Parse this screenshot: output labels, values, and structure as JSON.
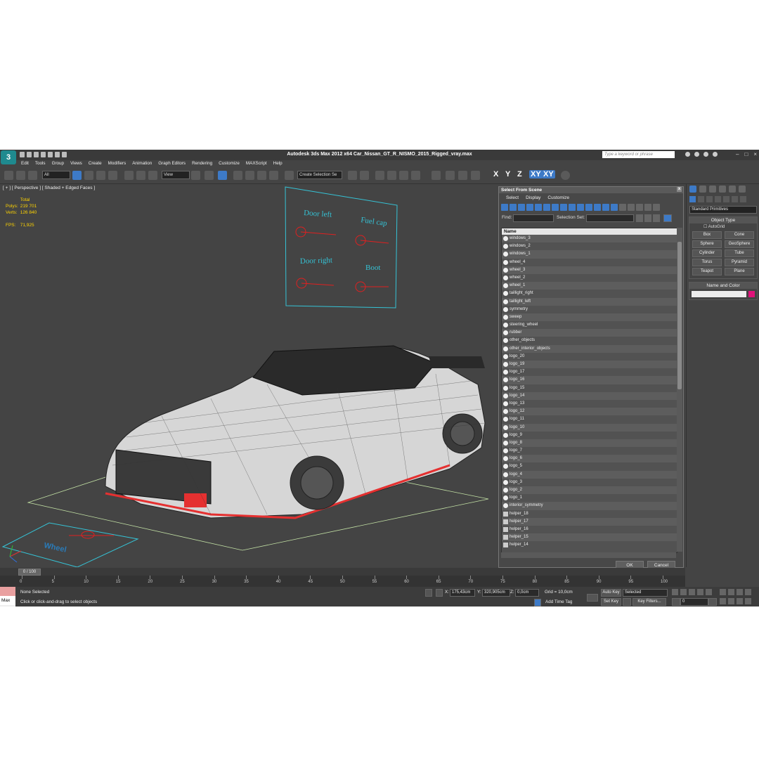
{
  "titlebar": {
    "title": "Autodesk 3ds Max  2012 x64     Car_Nissan_GT_R_NISMO_2015_Rigged_vray.max",
    "search_placeholder": "Type a keyword or phrase",
    "logo": "3"
  },
  "menu": [
    "Edit",
    "Tools",
    "Group",
    "Views",
    "Create",
    "Modifiers",
    "Animation",
    "Graph Editors",
    "Rendering",
    "Customize",
    "MAXScript",
    "Help"
  ],
  "toolbar": {
    "selection_filter": "All",
    "ref_coord": "View",
    "selection_set": "Create Selection Se",
    "axes": [
      "X",
      "Y",
      "Z",
      "XY",
      "XY"
    ]
  },
  "viewport": {
    "label": "[ + ] [ Perspective ] [ Shaded + Edged Faces ]",
    "stats": {
      "total_label": "Total",
      "polys_label": "Polys:",
      "polys": "219 701",
      "verts_label": "Verts:",
      "verts": "126 840",
      "fps_label": "FPS:",
      "fps": "71,925"
    },
    "controls": [
      "Door left",
      "Fuel cap",
      "Door right",
      "Boot"
    ],
    "wheel_label": "Wheel"
  },
  "dialog": {
    "title": "Select From Scene",
    "close": "x",
    "menu": [
      "Select",
      "Display",
      "Customize"
    ],
    "find_label": "Find:",
    "selection_set_label": "Selection Set:",
    "column_header": "Name",
    "items": [
      "windows_3",
      "windows_2",
      "windows_1",
      "wheel_4",
      "wheel_3",
      "wheel_2",
      "wheel_1",
      "taillight_right",
      "taillight_left",
      "symmetry",
      "sweep",
      "steering_wheel",
      "rubber",
      "other_objects",
      "other_interior_objects",
      "logo_20",
      "logo_19",
      "logo_17",
      "logo_16",
      "logo_15",
      "logo_14",
      "logo_13",
      "logo_12",
      "logo_11",
      "logo_10",
      "logo_9",
      "logo_8",
      "logo_7",
      "logo_6",
      "logo_5",
      "logo_4",
      "logo_3",
      "logo_2",
      "logo_1",
      "interior_symmetry",
      "helper_18",
      "helper_17",
      "helper_16",
      "helper_15",
      "helper_14"
    ],
    "ok": "OK",
    "cancel": "Cancel"
  },
  "cmdpanel": {
    "dropdown": "Standard Primitives",
    "object_type_title": "Object Type",
    "autogrid": "AutoGrid",
    "primitives": [
      "Box",
      "Cone",
      "Sphere",
      "GeoSphere",
      "Cylinder",
      "Tube",
      "Torus",
      "Pyramid",
      "Teapot",
      "Plane"
    ],
    "name_color_title": "Name and Color",
    "color": "#e0127a"
  },
  "timeline": {
    "frame": "0 / 100",
    "ticks": [
      "0",
      "5",
      "10",
      "15",
      "20",
      "25",
      "30",
      "35",
      "40",
      "45",
      "50",
      "55",
      "60",
      "65",
      "70",
      "75",
      "80",
      "85",
      "90",
      "95",
      "100"
    ]
  },
  "status": {
    "mini_listener": "Max",
    "selected": "None Selected",
    "prompt": "Click or click-and-drag to select objects",
    "x_label": "X:",
    "x": "175,43cm",
    "y_label": "Y:",
    "y": "320,905cm",
    "z_label": "Z:",
    "z": "0,0cm",
    "grid": "Grid = 10,0cm",
    "add_time_tag": "Add Time Tag",
    "auto_key": "Auto Key",
    "set_key": "Set Key",
    "selected_dropdown": "Selected",
    "key_filters": "Key Filters...",
    "frame_field": "0"
  }
}
